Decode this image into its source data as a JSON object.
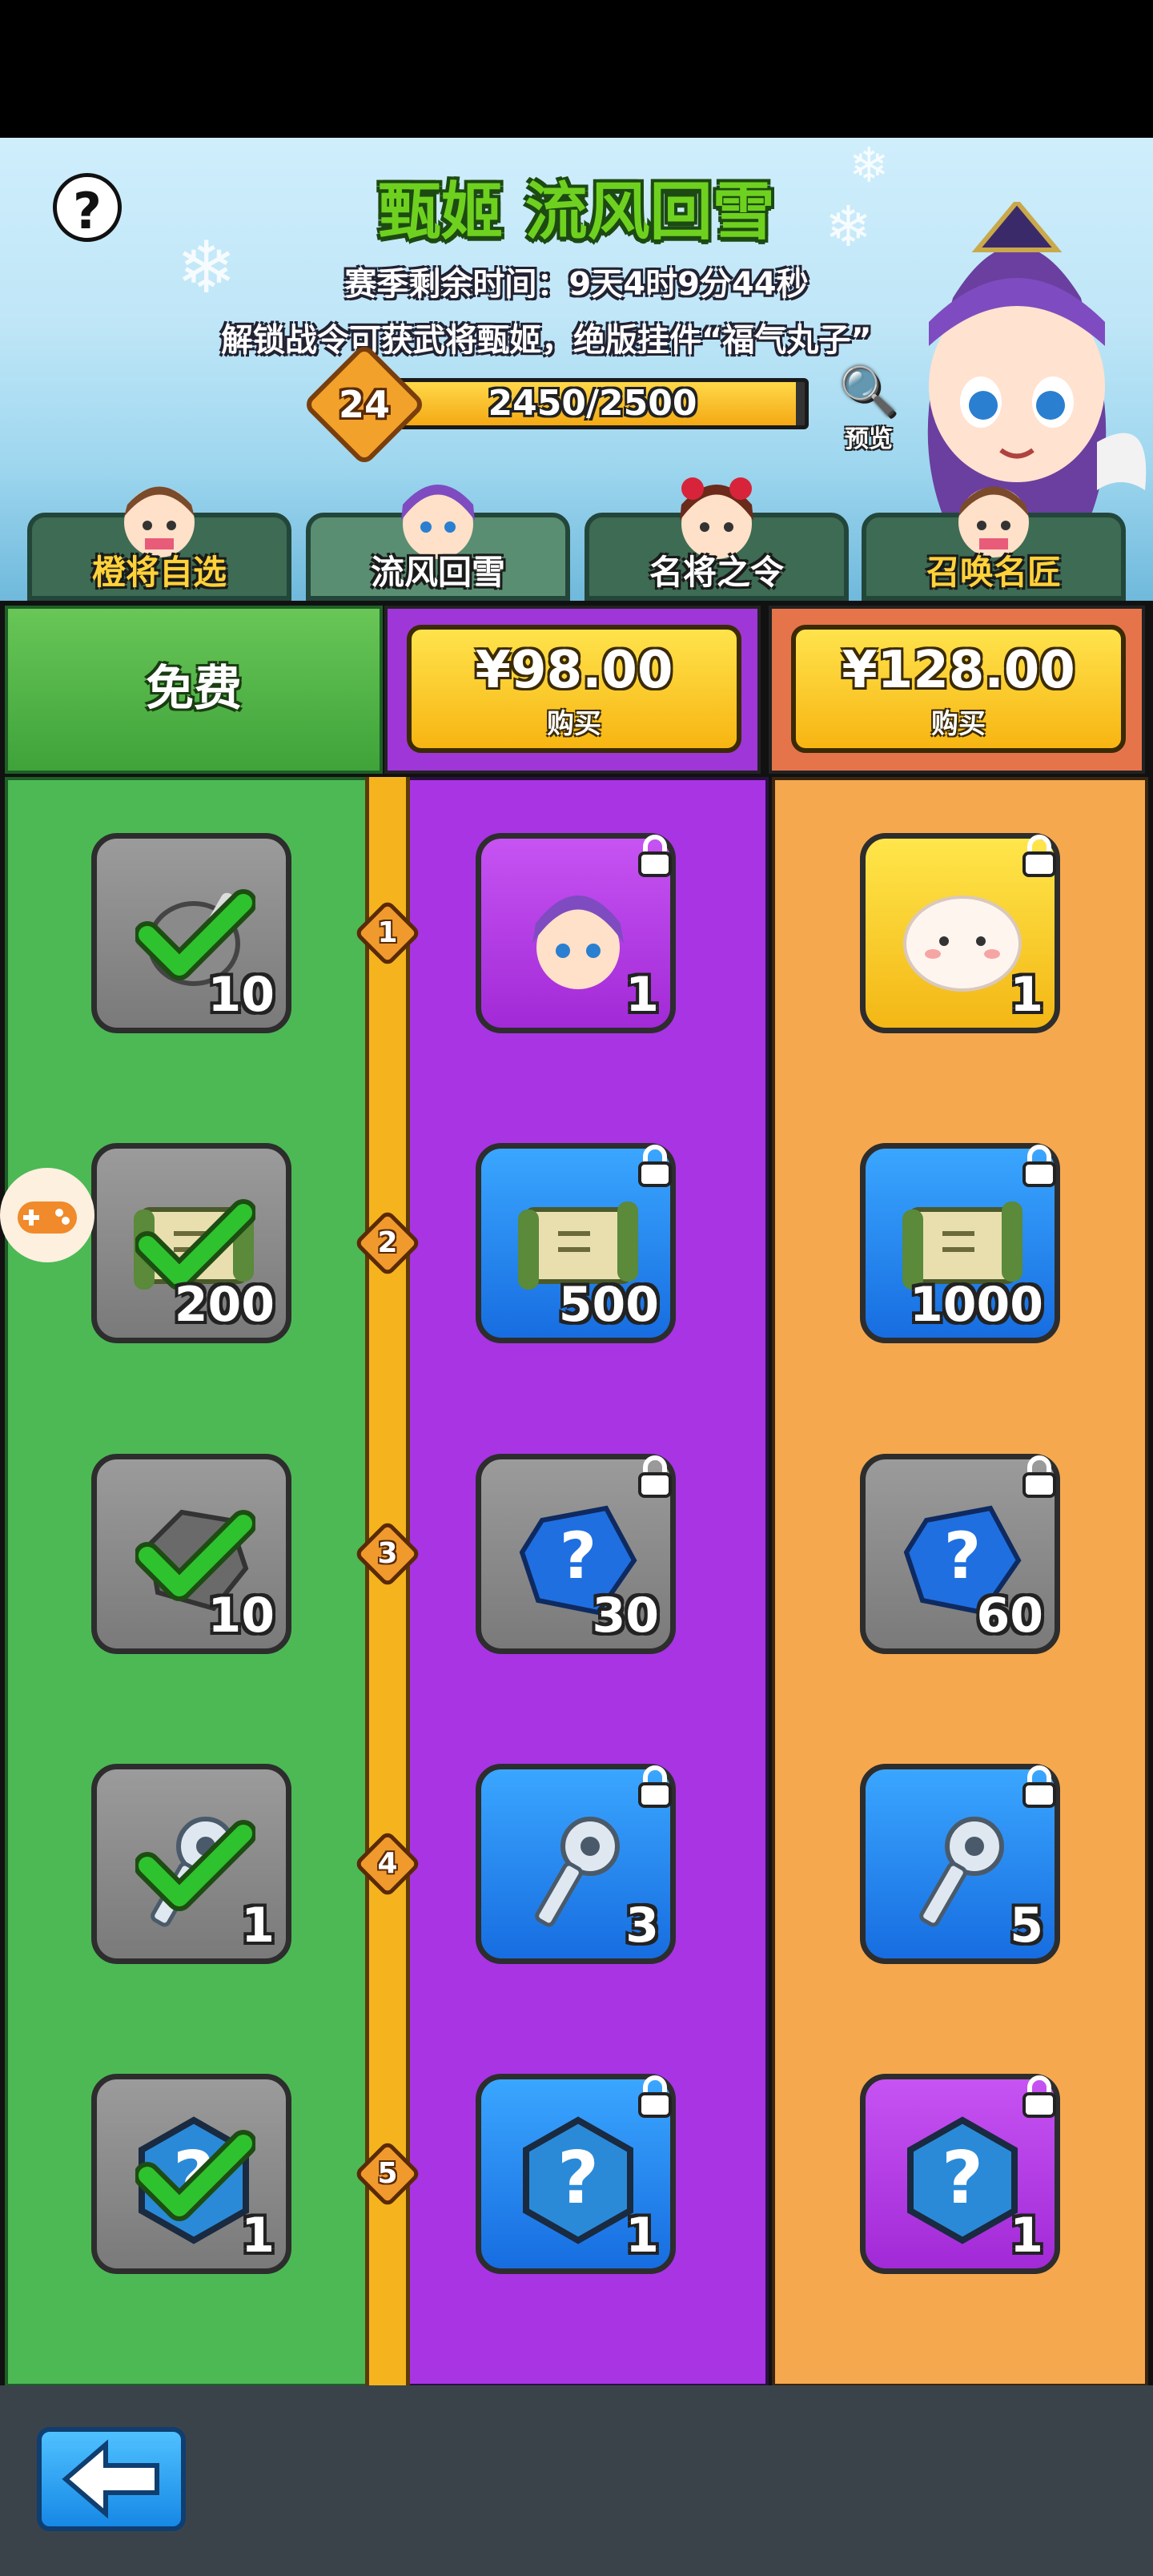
{
  "header": {
    "title": "甄姬 流风回雪",
    "season_remaining": "赛季剩余时间：9天4时9分44秒",
    "unlock_text": "解锁战令可获武将甄姬，绝版挂件“福气丸子”",
    "level": "24",
    "progress_text": "2450/2500",
    "progress_fraction": 0.98,
    "preview_label": "预览",
    "help_glyph": "?"
  },
  "tabs": [
    {
      "label": "橙将自选",
      "active": false
    },
    {
      "label": "流风回雪",
      "active": true
    },
    {
      "label": "名将之令",
      "active": false
    },
    {
      "label": "召唤名匠",
      "active": false
    }
  ],
  "columns": {
    "free": {
      "label": "免费"
    },
    "tier1": {
      "price": "¥98.00",
      "buy": "购买"
    },
    "tier2": {
      "price": "¥128.00",
      "buy": "购买"
    }
  },
  "levels": [
    "1",
    "2",
    "3",
    "4",
    "5"
  ],
  "rewards": {
    "free": [
      {
        "icon": "meat-icon",
        "qty": "10",
        "claimed": true
      },
      {
        "icon": "scroll-icon",
        "qty": "200",
        "claimed": true
      },
      {
        "icon": "ore-icon",
        "qty": "10",
        "claimed": true
      },
      {
        "icon": "key-icon",
        "qty": "1",
        "claimed": true
      },
      {
        "icon": "mystery-hex-icon",
        "qty": "1",
        "claimed": true
      }
    ],
    "tier1": [
      {
        "icon": "hero-zhenji-icon",
        "qty": "1"
      },
      {
        "icon": "scroll-icon",
        "qty": "500"
      },
      {
        "icon": "mystery-gem-icon",
        "qty": "30"
      },
      {
        "icon": "key-icon",
        "qty": "3"
      },
      {
        "icon": "mystery-hex-icon",
        "qty": "1"
      }
    ],
    "tier2": [
      {
        "icon": "dumpling-icon",
        "qty": "1"
      },
      {
        "icon": "scroll-icon",
        "qty": "1000"
      },
      {
        "icon": "mystery-gem-icon",
        "qty": "60"
      },
      {
        "icon": "key-icon",
        "qty": "5"
      },
      {
        "icon": "mystery-hex-icon",
        "qty": "1"
      }
    ]
  },
  "colors": {
    "free": "#4cb955",
    "tier1": "#a834e4",
    "tier2": "#f6a84e",
    "track": "#f5b41e"
  }
}
